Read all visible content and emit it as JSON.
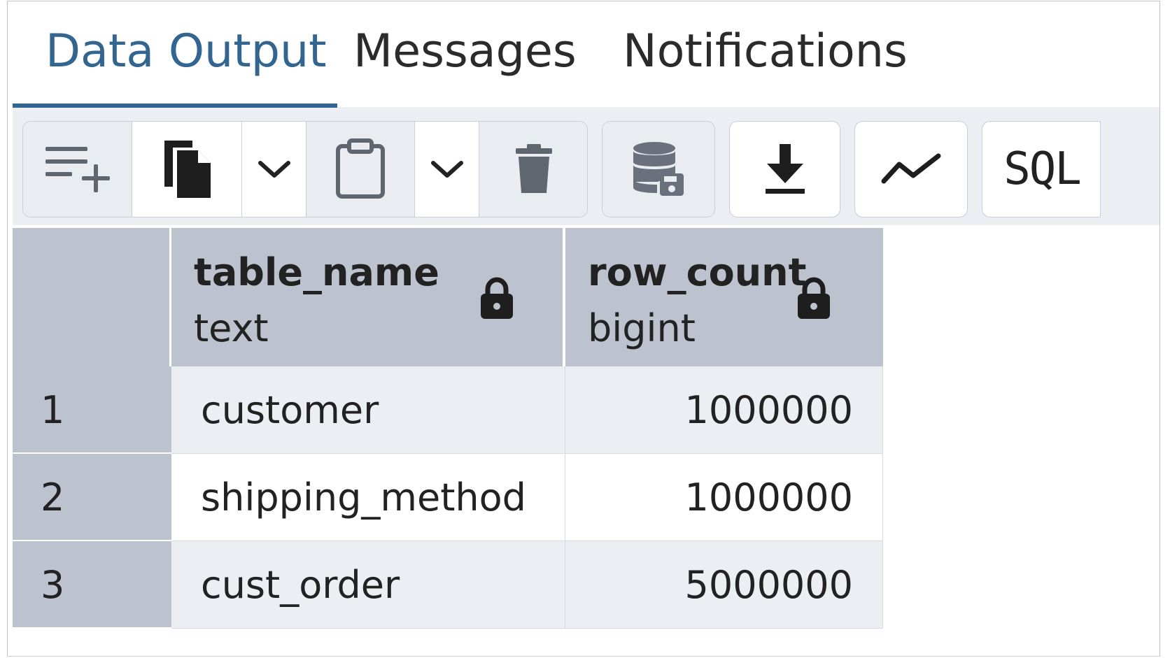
{
  "tabs": [
    {
      "label": "Data Output",
      "active": true
    },
    {
      "label": "Messages",
      "active": false
    },
    {
      "label": "Notifications",
      "active": false
    }
  ],
  "toolbar": {
    "buttons": [
      {
        "name": "add-row-button",
        "icon": "add-row-icon",
        "enabled": false
      },
      {
        "name": "copy-button",
        "icon": "copy-icon",
        "enabled": true
      },
      {
        "name": "copy-options-dropdown",
        "icon": "chevron-down-icon",
        "enabled": true
      },
      {
        "name": "paste-button",
        "icon": "paste-icon",
        "enabled": false
      },
      {
        "name": "paste-options-dropdown",
        "icon": "chevron-down-icon",
        "enabled": true
      },
      {
        "name": "delete-button",
        "icon": "trash-icon",
        "enabled": false
      },
      {
        "name": "save-data-button",
        "icon": "save-database-icon",
        "enabled": false
      },
      {
        "name": "download-button",
        "icon": "download-icon",
        "enabled": true
      },
      {
        "name": "graph-visualiser-button",
        "icon": "line-chart-icon",
        "enabled": true
      },
      {
        "name": "sql-button",
        "icon": "sql-icon",
        "enabled": true
      }
    ],
    "sql_label": "SQL"
  },
  "grid": {
    "columns": [
      {
        "name": "table_name",
        "type": "text",
        "icon": "lock-icon"
      },
      {
        "name": "row_count",
        "type": "bigint",
        "icon": "lock-icon"
      }
    ],
    "rows": [
      {
        "num": "1",
        "table_name": "customer",
        "row_count": "1000000"
      },
      {
        "num": "2",
        "table_name": "shipping_method",
        "row_count": "1000000"
      },
      {
        "num": "3",
        "table_name": "cust_order",
        "row_count": "5000000"
      }
    ]
  },
  "colors": {
    "accent": "#326690",
    "header_bg": "#bcc3cf",
    "toolbar_bg": "#ebeef3",
    "row_alt_bg": "#ebeef3"
  }
}
